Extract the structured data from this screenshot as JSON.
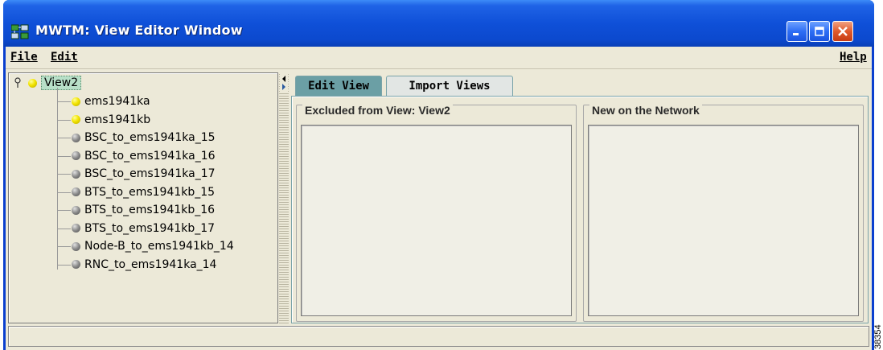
{
  "window": {
    "title": "MWTM: View Editor Window",
    "title_icon": "network-map-icon",
    "controls": [
      "minimize",
      "maximize",
      "close"
    ]
  },
  "menubar": {
    "file": "File",
    "edit": "Edit",
    "help": "Help"
  },
  "tree": {
    "root": {
      "label": "View2",
      "icon": "yellow-ball-icon",
      "expanded": true
    },
    "children": [
      {
        "label": "ems1941ka",
        "icon": "yellow-ball-icon"
      },
      {
        "label": "ems1941kb",
        "icon": "yellow-ball-icon"
      },
      {
        "label": "BSC_to_ems1941ka_15",
        "icon": "gray-ball-icon"
      },
      {
        "label": "BSC_to_ems1941ka_16",
        "icon": "gray-ball-icon"
      },
      {
        "label": "BSC_to_ems1941ka_17",
        "icon": "gray-ball-icon"
      },
      {
        "label": "BTS_to_ems1941kb_15",
        "icon": "gray-ball-icon"
      },
      {
        "label": "BTS_to_ems1941kb_16",
        "icon": "gray-ball-icon"
      },
      {
        "label": "BTS_to_ems1941kb_17",
        "icon": "gray-ball-icon"
      },
      {
        "label": "Node-B_to_ems1941kb_14",
        "icon": "gray-ball-icon"
      },
      {
        "label": "RNC_to_ems1941ka_14",
        "icon": "gray-ball-icon"
      }
    ]
  },
  "tabs": [
    {
      "label": "Edit View",
      "active": true
    },
    {
      "label": "Import Views",
      "active": false
    }
  ],
  "panels": {
    "excluded_title": "Excluded from View: View2",
    "new_title": "New on the Network"
  },
  "status": {
    "text": ""
  },
  "figure_id": "38354",
  "colors": {
    "titlebar": "#0c49ce",
    "client_bg": "#ece9d8",
    "active_tab": "#6b9fa5",
    "root_highlight": "#b8e0c8"
  }
}
